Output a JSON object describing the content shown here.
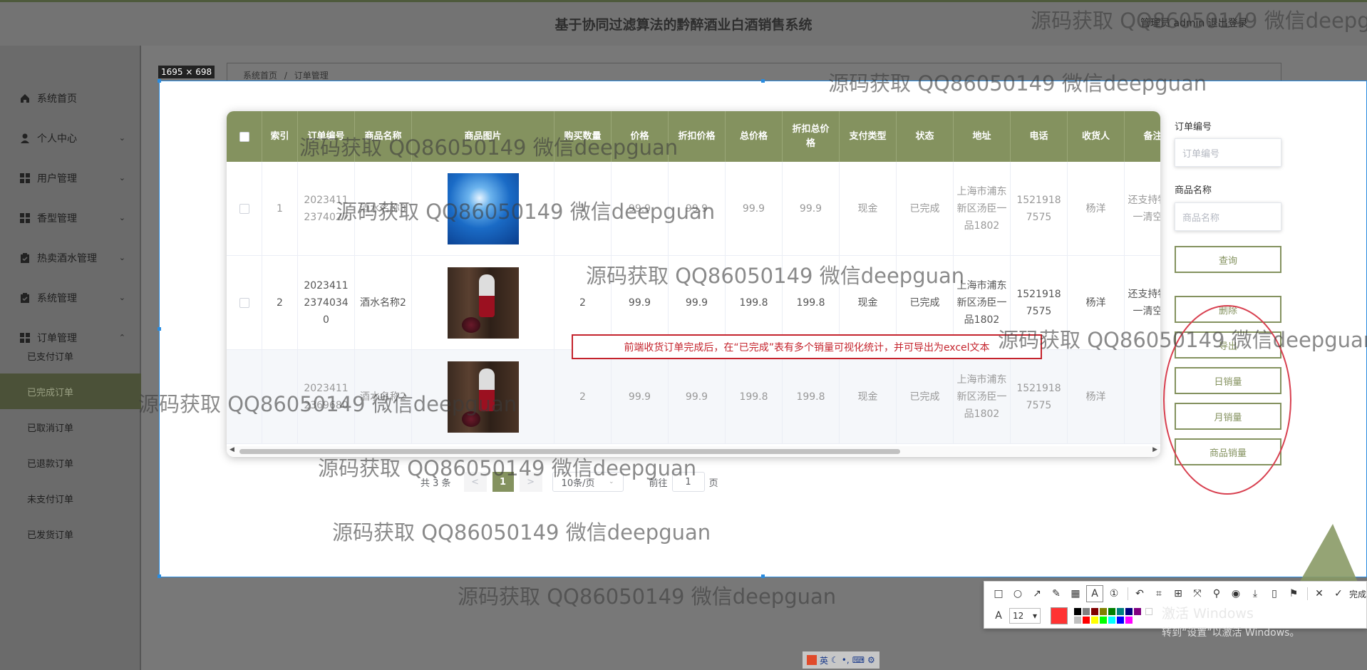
{
  "header": {
    "title": "基于协同过滤算法的黔醉酒业白酒销售系统",
    "user_text": "管理员 admin  退出登录"
  },
  "sidebar": {
    "items": [
      {
        "label": "系统首页",
        "icon": "home-icon",
        "chevron": ""
      },
      {
        "label": "个人中心",
        "icon": "user-icon",
        "chevron": "⌄"
      },
      {
        "label": "用户管理",
        "icon": "grid-icon",
        "chevron": "⌄"
      },
      {
        "label": "香型管理",
        "icon": "grid-icon",
        "chevron": "⌄"
      },
      {
        "label": "热卖酒水管理",
        "icon": "clipboard-icon",
        "chevron": "⌄"
      },
      {
        "label": "系统管理",
        "icon": "clipboard-icon",
        "chevron": "⌄"
      },
      {
        "label": "订单管理",
        "icon": "grid-icon",
        "chevron": "⌃"
      }
    ],
    "sub_items": [
      "已支付订单",
      "已完成订单",
      "已取消订单",
      "已退款订单",
      "未支付订单",
      "已发货订单"
    ]
  },
  "breadcrumb": {
    "home": "系统首页",
    "sep": "/",
    "current": "订单管理"
  },
  "capture": {
    "size_label": "1695 × 698"
  },
  "table": {
    "headers": [
      "",
      "索引",
      "订单编号",
      "商品名称",
      "商品图片",
      "购买数量",
      "价格",
      "折扣价格",
      "总价格",
      "折扣总价格",
      "支付类型",
      "状态",
      "地址",
      "电话",
      "收货人",
      "备注"
    ],
    "rows": [
      {
        "index": "1",
        "order_no": "20234112374027",
        "name": "酒水名称3",
        "image": "blue-cocktail",
        "qty": "1",
        "price": "99.9",
        "discount": "99.9",
        "total": "99.9",
        "discount_total": "99.9",
        "pay": "现金",
        "status": "已完成",
        "address": "上海市浦东新区汤臣一品1802",
        "phone": "15219187575",
        "receiver": "杨洋",
        "note": "还支持物车一清空格"
      },
      {
        "index": "2",
        "order_no": "20234112374034 0",
        "name": "酒水名称2",
        "image": "red-wine",
        "qty": "2",
        "price": "99.9",
        "discount": "99.9",
        "total": "199.8",
        "discount_total": "199.8",
        "pay": "现金",
        "status": "已完成",
        "address": "上海市浦东新区汤臣一品1802",
        "phone": "15219187575",
        "receiver": "杨洋",
        "note": "还支持物车一清空格"
      },
      {
        "index": "",
        "order_no": "20234112369680",
        "name": "酒水名称2",
        "image": "red-wine",
        "qty": "2",
        "price": "99.9",
        "discount": "99.9",
        "total": "199.8",
        "discount_total": "199.8",
        "pay": "现金",
        "status": "已完成",
        "address": "上海市浦东新区汤臣一品1802",
        "phone": "15219187575",
        "receiver": "杨洋",
        "note": ""
      }
    ]
  },
  "pagination": {
    "total": "共 3 条",
    "prev": "<",
    "page": "1",
    "next": ">",
    "page_size": "10条/页",
    "goto_label": "前往",
    "goto_value": "1",
    "page_unit": "页"
  },
  "search": {
    "order_label": "订单编号",
    "order_placeholder": "订单编号",
    "name_label": "商品名称",
    "name_placeholder": "商品名称",
    "query": "查询",
    "delete": "删除",
    "export": "导出",
    "daily": "日销量",
    "monthly": "月销量",
    "product": "商品销量"
  },
  "annotation": {
    "note": "前端收货订单完成后，在“已完成”表有多个销量可视化统计，并可导出为excel文本",
    "ellipse_color": "#d84050"
  },
  "watermark": "源码获取 QQ86050149 微信deepguan",
  "toolbar": {
    "font_size": "12",
    "done": "完成",
    "colors": [
      "#000000",
      "#808080",
      "#800000",
      "#808000",
      "#008000",
      "#008080",
      "#000080",
      "#800080",
      "#ffffff",
      "#c0c0c0",
      "#ff0000",
      "#ffff00",
      "#00ff00",
      "#00ffff",
      "#0000ff",
      "#ff00ff"
    ],
    "active_color": "#ff3333"
  },
  "activation": {
    "line1": "激活 Windows",
    "line2": "转到“设置”以激活 Windows。"
  },
  "ime": {
    "lang": "英"
  },
  "colors": {
    "accent": "#84925f",
    "annotation_red": "#c4232c"
  }
}
